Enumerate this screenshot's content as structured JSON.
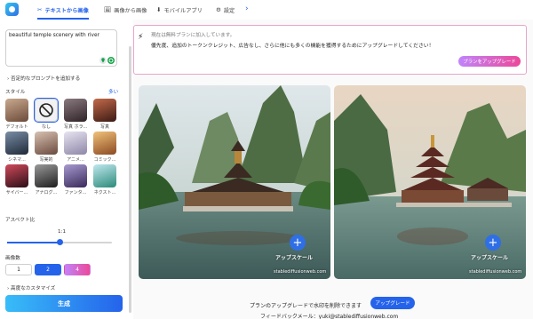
{
  "nav": {
    "tabs": [
      {
        "icon": "✂",
        "label": "テキストから画像"
      },
      {
        "icon": "🖼",
        "label": "画像から画像"
      },
      {
        "icon": "⬇",
        "label": "モバイルアプリ"
      },
      {
        "icon": "⚙",
        "label": "設定"
      }
    ],
    "more_icon": "chevron-right"
  },
  "prompt": {
    "value": "beautiful temple scenery with river"
  },
  "negative_prompt": {
    "label": "否定的なプロンプトを追加する"
  },
  "style": {
    "label": "スタイル",
    "more": "多い",
    "items": [
      {
        "label": "デフォルト",
        "color": "#8a6b55"
      },
      {
        "label": "なし",
        "color": "#f2f2f2"
      },
      {
        "label": "写真 ホラ...",
        "color": "#5a4a52"
      },
      {
        "label": "写真",
        "color": "#7a3a2c"
      },
      {
        "label": "シネマ...",
        "color": "#3d4f63"
      },
      {
        "label": "写実的",
        "color": "#9a7b6a"
      },
      {
        "label": "アニメ...",
        "color": "#b9b3c8"
      },
      {
        "label": "コミック...",
        "color": "#c98a4a"
      },
      {
        "label": "サイバー...",
        "color": "#7d2a36"
      },
      {
        "label": "アナログ...",
        "color": "#3a3a3a"
      },
      {
        "label": "ファンタ...",
        "color": "#6a5a8a"
      },
      {
        "label": "ネクスト...",
        "color": "#4aa8b0"
      }
    ]
  },
  "aspect": {
    "label": "アスペクト比",
    "value": "1:1",
    "position": 0.5
  },
  "count": {
    "label": "画像数",
    "options": [
      "1",
      "2",
      "4"
    ],
    "selected": "2"
  },
  "advanced": {
    "label": "高度なカスタマイズ"
  },
  "generate": {
    "label": "生成"
  },
  "banner": {
    "line1": "現在は無料プランに加入しています。",
    "line2": "優先度、追加のトークンクレジット、広告なし、さらに他にも多くの機能を獲得するためにアップグレードしてください！",
    "button": "プランをアップグレード"
  },
  "results": [
    {
      "upscale": "アップスケール",
      "watermark": "stablediffusionweb.com"
    },
    {
      "upscale": "アップスケール",
      "watermark": "stablediffusionweb.com"
    }
  ],
  "footer": {
    "text": "プランのアップグレードで水印を削除できます",
    "button": "アップグレード",
    "feedback": "フィードバックメール：yuki@stablediffusionweb.com"
  },
  "colors": {
    "accent": "#2563eb",
    "banner_border": "#e7a6c8",
    "upgrade_gradient": [
      "#c084fc",
      "#ec4899"
    ],
    "generate_gradient": [
      "#38bdf8",
      "#2563eb"
    ]
  }
}
